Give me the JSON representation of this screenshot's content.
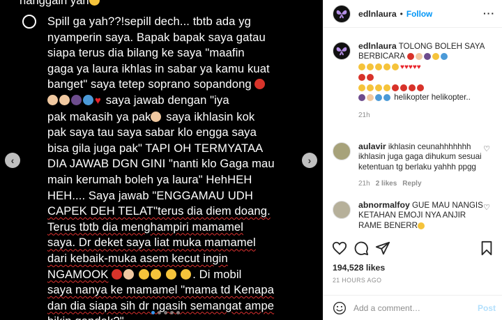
{
  "media": {
    "header_text": "nanggain yah",
    "lines": [
      "Spill ga yah??!sepill dech... tbtb ada yg",
      "nyamperin saya. Bapak bapak saya gatau",
      "siapa terus dia bilang ke saya \"maafin",
      "gaga ya laura ikhlas in sabar ya kamu kuat",
      "banget\" saya tetep soprano sopandong",
      "saya jawab dengan \"iya",
      "pak makasih ya pak",
      "saya ikhlasin kok",
      "pak saya tau saya sabar klo engga saya",
      "bisa gila juga pak\" TAPI OH TERMYATAA",
      "DIA JAWAB DGN GINI \"nanti klo Gaga mau",
      "main kerumah boleh ya laura\" HehHEH",
      "HEH.... Saya jawab \"ENGGAMAU UDH",
      "CAPEK DEH TELAT\"terus dia diem doang.",
      "Terus tbtb dia menghampiri mamamel",
      "saya. Dr deket saya liat muka mamamel",
      "dari kebaik-muka asem kecut ingin",
      "NGAMOOK",
      "Di mobil",
      "saya nanya ke mamamel \"mama td Kenapa",
      "dan dia siapa sih dr ngasih semangat ampe",
      "bikin gondok?\""
    ]
  },
  "header": {
    "username": "edlnlaura",
    "dot": "•",
    "follow_label": "Follow"
  },
  "caption": {
    "username": "edlnlaura",
    "text": "TOLONG BOLEH SAYA BERBICARA",
    "tail": "helikopter helikopter..",
    "time": "21h"
  },
  "comments": [
    {
      "username": "aulavir",
      "text": "ikhlasin ceunahhhhhhh ikhlasin juga gaga dihukum sesuai ketentuan tg berlaku yahhh ppgg",
      "time": "21h",
      "likes": "2 likes",
      "reply": "Reply"
    },
    {
      "username": "abnormalfoy",
      "text": "GUE MAU NANGIS KETAHAN EMOJI NYA ANJIR RAME BENERR"
    }
  ],
  "stats": {
    "likes": "194,528 likes",
    "time_ago": "21 HOURS AGO"
  },
  "add_comment": {
    "placeholder": "Add a comment…",
    "post_label": "Post"
  },
  "colors": {
    "accent": "#0095f6",
    "text": "#262626",
    "muted": "#8e8e8e",
    "media_bg": "#000000"
  }
}
